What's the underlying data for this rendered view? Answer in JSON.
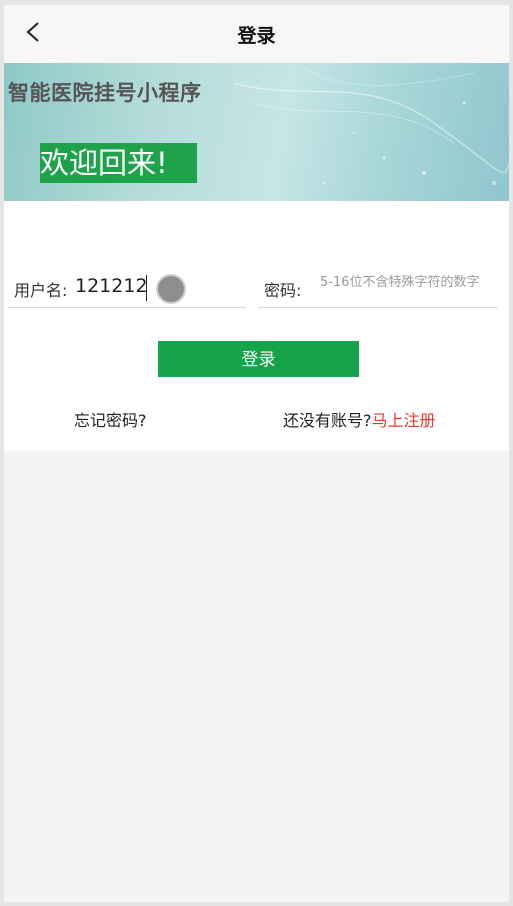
{
  "navbar": {
    "back_icon": "chevron-left-icon",
    "title": "登录"
  },
  "banner": {
    "app_name": "智能医院挂号小程序",
    "welcome": "欢迎回来!"
  },
  "form": {
    "username_label": "用户名:",
    "username_value": "121212",
    "password_label": "密码:",
    "password_placeholder": "5-16位不含特殊字符的数字"
  },
  "actions": {
    "login_label": "登录",
    "forgot_label": "忘记密码?",
    "no_account_text": "还没有账号?",
    "register_label": "马上注册"
  },
  "colors": {
    "accent_green": "#17a34a",
    "link_red": "#e43b2c"
  }
}
